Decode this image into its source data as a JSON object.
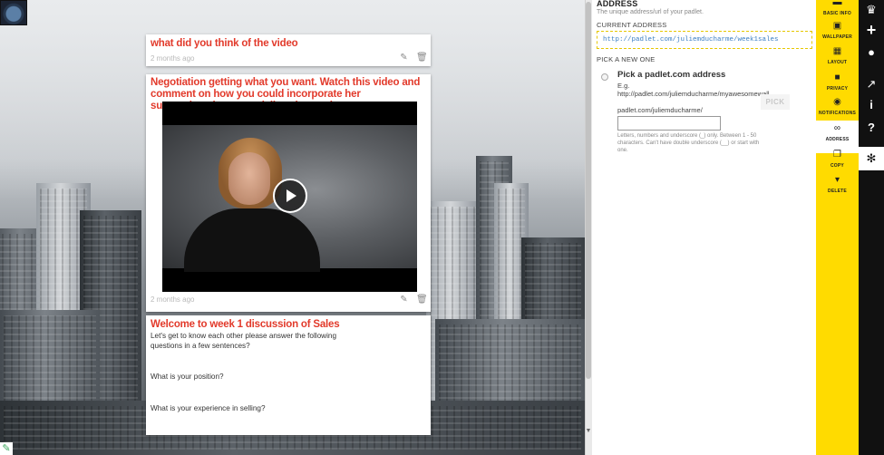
{
  "posts": [
    {
      "title": "what did you think of the video",
      "meta": "2 months ago"
    },
    {
      "title": "Negotiation getting what you want. Watch this video and comment on how you could incorporate her suggestions into your daily sales work.",
      "meta": "2 months ago"
    },
    {
      "title": "Welcome to week 1 discussion of Sales",
      "body": [
        "Let's get to know each other please answer the following questions in a few sentences?",
        "What is your position?",
        "What is your experience in selling?"
      ]
    }
  ],
  "panel": {
    "heading": "ADDRESS",
    "subtitle": "The unique address/url of your padlet.",
    "current_label": "CURRENT ADDRESS",
    "current_url": "http://padlet.com/juliemducharme/week1sales",
    "pick_label": "PICK A NEW ONE",
    "option_title": "Pick a padlet.com address",
    "eg_label": "E.g.",
    "example_url": "http://padlet.com/juliemducharme/myawesomewall",
    "pick_button": "PICK",
    "prefix": "padlet.com/juliemducharme/",
    "slug_value": "",
    "hint": "Letters, numbers and underscore (_) only. Between 1 - 50 characters. Can't have double underscore (__) or start with one."
  },
  "tabs": [
    {
      "label": "BASIC INFO",
      "icon": "basic-info-icon",
      "glyph": "▬"
    },
    {
      "label": "WALLPAPER",
      "icon": "wallpaper-icon",
      "glyph": "▣"
    },
    {
      "label": "LAYOUT",
      "icon": "layout-icon",
      "glyph": "▦"
    },
    {
      "label": "PRIVACY",
      "icon": "lock-icon",
      "glyph": "■"
    },
    {
      "label": "NOTIFICATIONS",
      "icon": "eye-icon",
      "glyph": "◉"
    },
    {
      "label": "ADDRESS",
      "icon": "link-icon",
      "glyph": "∞"
    },
    {
      "label": "COPY",
      "icon": "copy-icon",
      "glyph": "❐"
    },
    {
      "label": "DELETE",
      "icon": "trash-icon",
      "glyph": "▾"
    }
  ],
  "rail": [
    {
      "icon": "crown-icon",
      "glyph": "♛"
    },
    {
      "icon": "plus-icon",
      "glyph": "+"
    },
    {
      "icon": "user-icon",
      "glyph": "●"
    },
    {
      "icon": "share-icon",
      "glyph": "↗"
    },
    {
      "icon": "info-icon",
      "glyph": "i"
    },
    {
      "icon": "help-icon",
      "glyph": "?"
    },
    {
      "icon": "gear-icon",
      "glyph": "✻"
    }
  ],
  "icons": {
    "edit": "✎",
    "trash": "🗑",
    "brand_glyph": "✎"
  },
  "colors": {
    "title_red": "#e23a2b",
    "tab_yellow": "#ffdb00",
    "rail_dark": "#111111",
    "link_blue": "#3b7fc4"
  }
}
